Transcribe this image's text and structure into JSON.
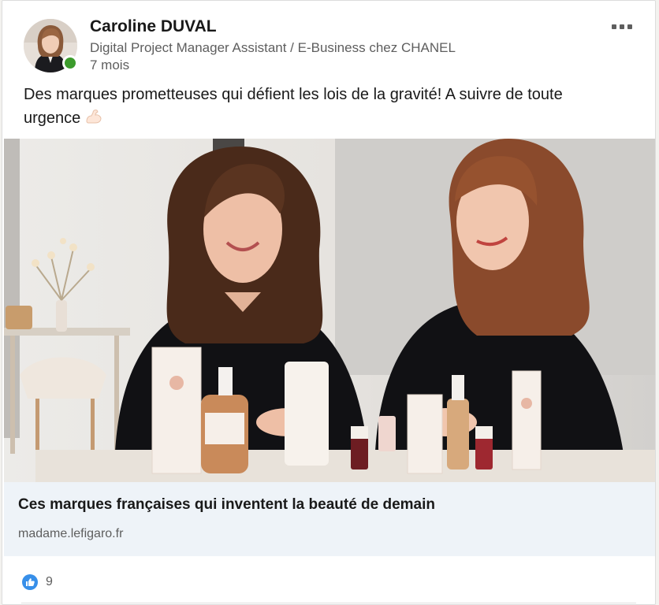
{
  "post": {
    "author_name": "Caroline DUVAL",
    "author_headline": "Digital Project Manager Assistant / E-Business chez CHANEL",
    "time_ago": "7 mois",
    "text": "Des marques prometteuses qui défient les lois de la gravité! A suivre de toute urgence",
    "emoji": "flexed-biceps-icon"
  },
  "article": {
    "title": "Ces marques françaises qui inventent la beauté de demain",
    "source": "madame.lefigaro.fr"
  },
  "social": {
    "reaction_icon": "like-icon",
    "reaction_count": "9"
  },
  "colors": {
    "like_blue": "#378fe9",
    "presence_green": "#3c9b2c",
    "article_bg": "#eef3f8"
  }
}
